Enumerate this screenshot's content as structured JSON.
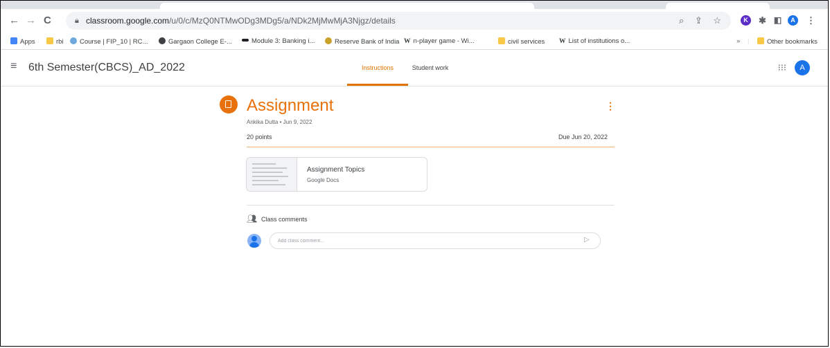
{
  "browser": {
    "url_host": "classroom.google.com",
    "url_path": "/u/0/c/MzQ0NTMwODg3MDg5/a/NDk2MjMwMjA3Njgz/details",
    "nav": {
      "back": "←",
      "forward": "→",
      "reload": "C"
    },
    "omni_icons": [
      "search-icon",
      "share-icon",
      "star-icon"
    ],
    "profile_initial": "A"
  },
  "bookmarks": {
    "apps": "Apps",
    "items": [
      "rbi",
      "Course | FIP_10 | RC...",
      "Gargaon College E-...",
      "Module 3: Banking i...",
      "Reserve Bank of India",
      "n-player game - Wi...",
      "civil services",
      "List of institutions o..."
    ],
    "overflow": "»",
    "other": "Other bookmarks"
  },
  "header": {
    "class_title": "6th Semester(CBCS)_AD_2022",
    "tabs": [
      "Instructions",
      "Student work"
    ],
    "avatar_initial": "A"
  },
  "assignment": {
    "title": "Assignment",
    "meta": "Ankika Dutta • Jun 9, 2022",
    "points": "20 points",
    "due": "Due Jun 20, 2022",
    "attachment": {
      "title": "Assignment Topics",
      "subtitle": "Google Docs"
    }
  },
  "comments": {
    "label": "Class comments",
    "placeholder": "Add class comment..."
  },
  "colors": {
    "accent": "#e8710a",
    "brand_blue": "#1a73e8"
  }
}
